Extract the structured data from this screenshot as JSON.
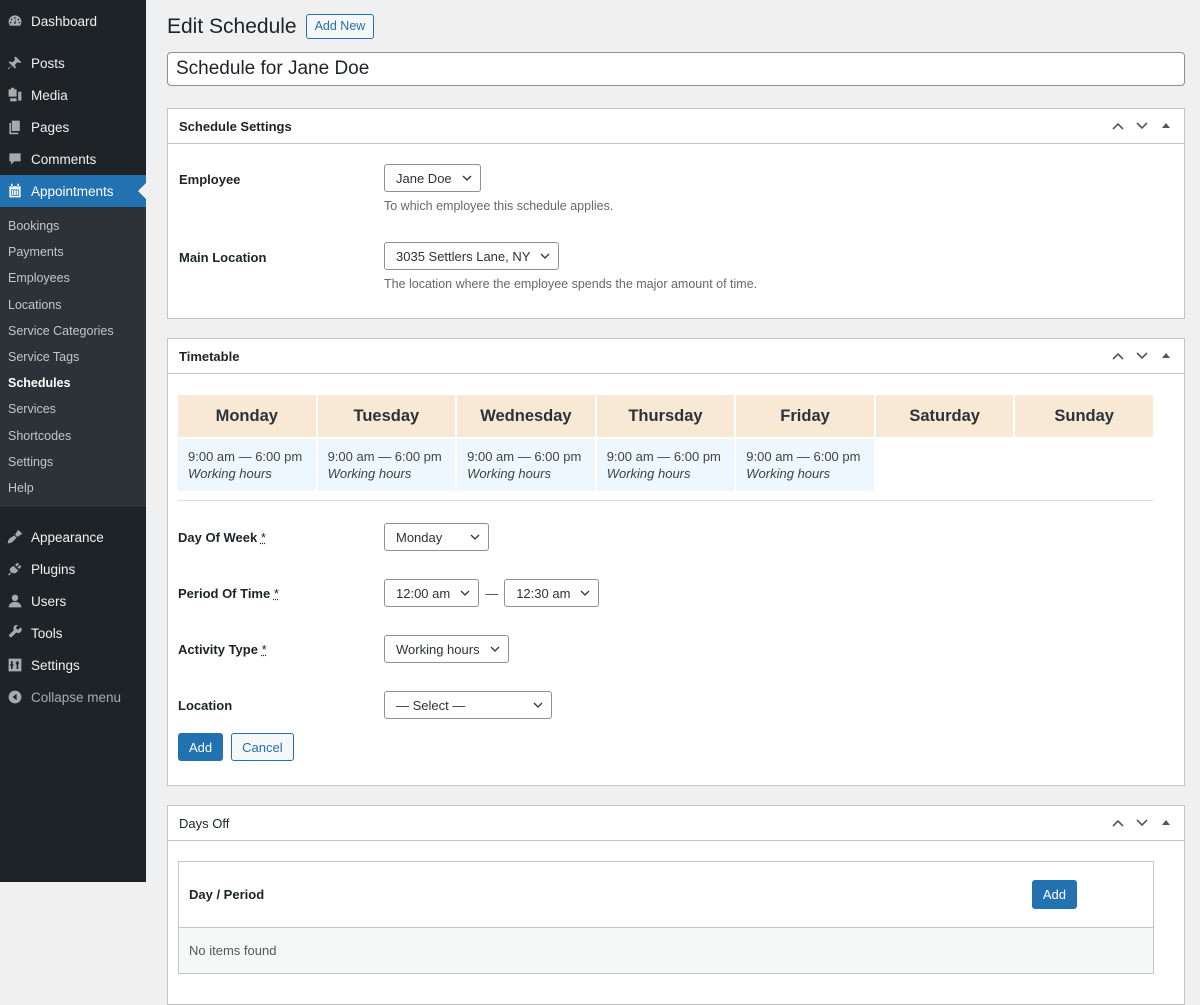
{
  "sidebar": {
    "top_items": [
      {
        "label": "Dashboard",
        "icon": "dashboard-icon"
      },
      {
        "label": "Posts",
        "icon": "pin-icon"
      },
      {
        "label": "Media",
        "icon": "media-icon"
      },
      {
        "label": "Pages",
        "icon": "pages-icon"
      },
      {
        "label": "Comments",
        "icon": "comment-icon"
      },
      {
        "label": "Appointments",
        "icon": "calendar-icon",
        "active": true
      }
    ],
    "submenu": [
      "Bookings",
      "Payments",
      "Employees",
      "Locations",
      "Service Categories",
      "Service Tags",
      "Schedules",
      "Services",
      "Shortcodes",
      "Settings",
      "Help"
    ],
    "submenu_current": "Schedules",
    "bottom_items": [
      {
        "label": "Appearance",
        "icon": "brush-icon"
      },
      {
        "label": "Plugins",
        "icon": "plug-icon"
      },
      {
        "label": "Users",
        "icon": "user-icon"
      },
      {
        "label": "Tools",
        "icon": "wrench-icon"
      },
      {
        "label": "Settings",
        "icon": "sliders-icon"
      }
    ],
    "collapse_label": "Collapse menu"
  },
  "header": {
    "title": "Edit Schedule",
    "add_new_label": "Add New",
    "post_title_value": "Schedule for Jane Doe"
  },
  "schedule_settings": {
    "title": "Schedule Settings",
    "employee_label": "Employee",
    "employee_value": "Jane Doe",
    "employee_desc": "To which employee this schedule applies.",
    "location_label": "Main Location",
    "location_value": "3035 Settlers Lane, NY",
    "location_desc": "The location where the employee spends the major amount of time."
  },
  "timetable": {
    "title": "Timetable",
    "days": [
      {
        "name": "Monday",
        "time": "9:00 am — 6:00 pm",
        "type": "Working hours"
      },
      {
        "name": "Tuesday",
        "time": "9:00 am — 6:00 pm",
        "type": "Working hours"
      },
      {
        "name": "Wednesday",
        "time": "9:00 am — 6:00 pm",
        "type": "Working hours"
      },
      {
        "name": "Thursday",
        "time": "9:00 am — 6:00 pm",
        "type": "Working hours"
      },
      {
        "name": "Friday",
        "time": "9:00 am — 6:00 pm",
        "type": "Working hours"
      },
      {
        "name": "Saturday",
        "time": "",
        "type": ""
      },
      {
        "name": "Sunday",
        "time": "",
        "type": ""
      }
    ],
    "form": {
      "day_label": "Day Of Week",
      "day_value": "Monday",
      "period_label": "Period Of Time",
      "period_start": "12:00 am",
      "period_separator": "—",
      "period_end": "12:30 am",
      "activity_label": "Activity Type",
      "activity_value": "Working hours",
      "location_label": "Location",
      "location_value": "— Select —",
      "required_mark": "*",
      "add_label": "Add",
      "cancel_label": "Cancel"
    }
  },
  "days_off": {
    "title": "Days Off",
    "column": "Day / Period",
    "add_label": "Add",
    "empty_text": "No items found"
  },
  "colors": {
    "accent": "#2271b1",
    "sidebar_bg": "#1d2327",
    "submenu_bg": "#2c3338",
    "day_header_bg": "#f8e9d5",
    "working_cell_bg": "#eef6fe"
  }
}
